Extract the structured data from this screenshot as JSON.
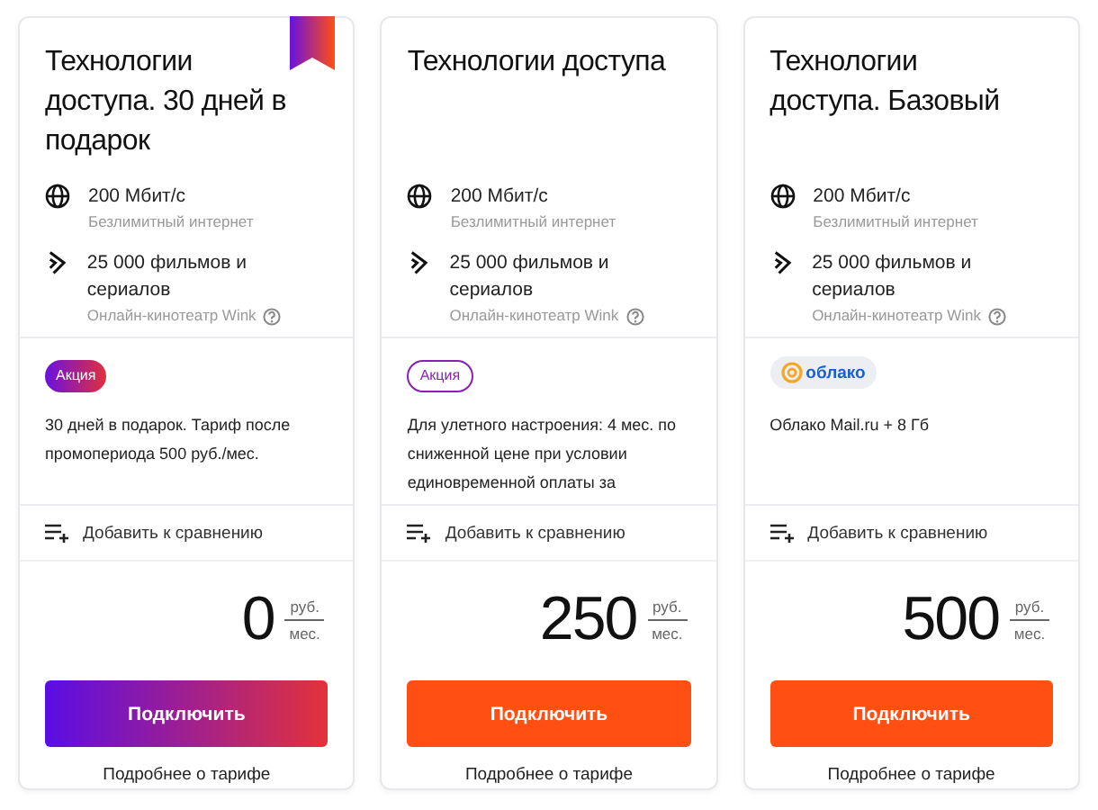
{
  "tariffs": [
    {
      "title": "Технологии доступа. 30 дней в подарок",
      "ribbon": true,
      "features": [
        {
          "kind": "globe",
          "title": "200 Мбит/с",
          "note": "Безлимитный интернет",
          "help": false
        },
        {
          "kind": "wink",
          "title": "25 000 фильмов и сериалов",
          "note": "Онлайн-кинотеатр Wink",
          "help": true
        }
      ],
      "badge": {
        "kind": "promo_filled",
        "label": "Акция"
      },
      "promo_text": "30 дней в подарок. Тариф после промопериода 500 руб./мес.",
      "compare": "Добавить к сравнению",
      "price": "0",
      "unit_top": "руб.",
      "unit_bottom": "мес.",
      "button": {
        "kind": "gradient",
        "label": "Подключить"
      },
      "details": "Подробнее о тарифе"
    },
    {
      "title": "Технологии доступа",
      "ribbon": false,
      "features": [
        {
          "kind": "globe",
          "title": "200 Мбит/с",
          "note": "Безлимитный интернет",
          "help": false
        },
        {
          "kind": "wink",
          "title": "25 000 фильмов и сериалов",
          "note": "Онлайн-кинотеатр Wink",
          "help": true
        }
      ],
      "badge": {
        "kind": "promo_outline",
        "label": "Акция"
      },
      "promo_text": "Для улетного настроения: 4 мес. по сниженной цене при условии единовременной оплаты за",
      "compare": "Добавить к сравнению",
      "price": "250",
      "unit_top": "руб.",
      "unit_bottom": "мес.",
      "button": {
        "kind": "orange",
        "label": "Подключить"
      },
      "details": "Подробнее о тарифе"
    },
    {
      "title": "Технологии доступа. Базовый",
      "ribbon": false,
      "features": [
        {
          "kind": "globe",
          "title": "200 Мбит/с",
          "note": "Безлимитный интернет",
          "help": false
        },
        {
          "kind": "wink",
          "title": "25 000 фильмов и сериалов",
          "note": "Онлайн-кинотеатр Wink",
          "help": true
        }
      ],
      "badge": {
        "kind": "cloud",
        "label": "облако"
      },
      "promo_text": "Облако Mail.ru + 8 Гб",
      "compare": "Добавить к сравнению",
      "price": "500",
      "unit_top": "руб.",
      "unit_bottom": "мес.",
      "button": {
        "kind": "orange",
        "label": "Подключить"
      },
      "details": "Подробнее о тарифе"
    }
  ]
}
